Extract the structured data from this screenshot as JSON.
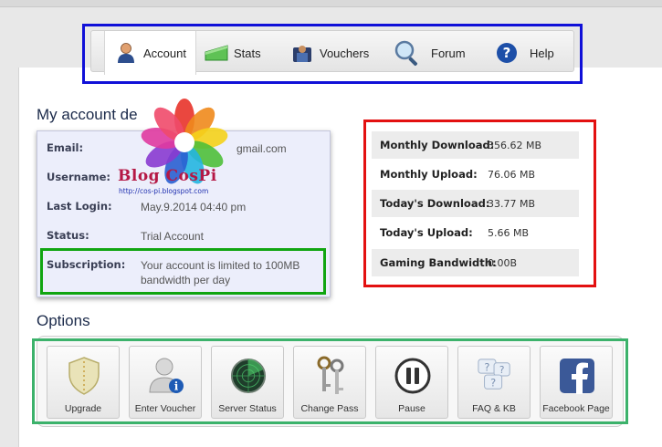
{
  "nav": {
    "tabs": [
      {
        "label": "Account",
        "icon": "user-icon",
        "active": true
      },
      {
        "label": "Stats",
        "icon": "stats-icon",
        "active": false
      },
      {
        "label": "Vouchers",
        "icon": "vouchers-icon",
        "active": false
      },
      {
        "label": "Forum",
        "icon": "forum-search-icon",
        "active": false
      },
      {
        "label": "Help",
        "icon": "help-icon",
        "active": false
      }
    ]
  },
  "account": {
    "heading": "My account de",
    "rows": [
      {
        "label": "Email:",
        "value": "gmail.com"
      },
      {
        "label": "Username:",
        "value": ""
      },
      {
        "label": "Last Login:",
        "value": "May.9.2014 04:40 pm"
      },
      {
        "label": "Status:",
        "value": "Trial Account"
      },
      {
        "label": "Subscription:",
        "value": "Your account is limited to 100MB bandwidth per day"
      }
    ]
  },
  "watermark": {
    "text": "Blog CosPi",
    "url": "http://cos-pi.blogspot.com"
  },
  "stats": {
    "rows": [
      {
        "label": "Monthly Download:",
        "value": "356.62 MB"
      },
      {
        "label": "Monthly Upload:",
        "value": "76.06 MB"
      },
      {
        "label": "Today's Download:",
        "value": "33.77 MB"
      },
      {
        "label": "Today's Upload:",
        "value": "5.66 MB"
      },
      {
        "label": "Gaming Bandwidth:",
        "value": "0.00B"
      }
    ]
  },
  "options": {
    "heading": "Options",
    "buttons": [
      {
        "label": "Upgrade",
        "icon": "shield-icon"
      },
      {
        "label": "Enter Voucher",
        "icon": "user-info-icon"
      },
      {
        "label": "Server Status",
        "icon": "radar-icon"
      },
      {
        "label": "Change Pass",
        "icon": "keys-icon"
      },
      {
        "label": "Pause",
        "icon": "pause-icon"
      },
      {
        "label": "FAQ & KB",
        "icon": "faq-bubbles-icon"
      },
      {
        "label": "Facebook Page",
        "icon": "facebook-icon"
      }
    ]
  },
  "colors": {
    "nav_highlight": "#1010d8",
    "stats_highlight": "#e31010",
    "subscription_highlight": "#11a511",
    "options_highlight": "#3cb26b",
    "facebook": "#3b5998"
  }
}
